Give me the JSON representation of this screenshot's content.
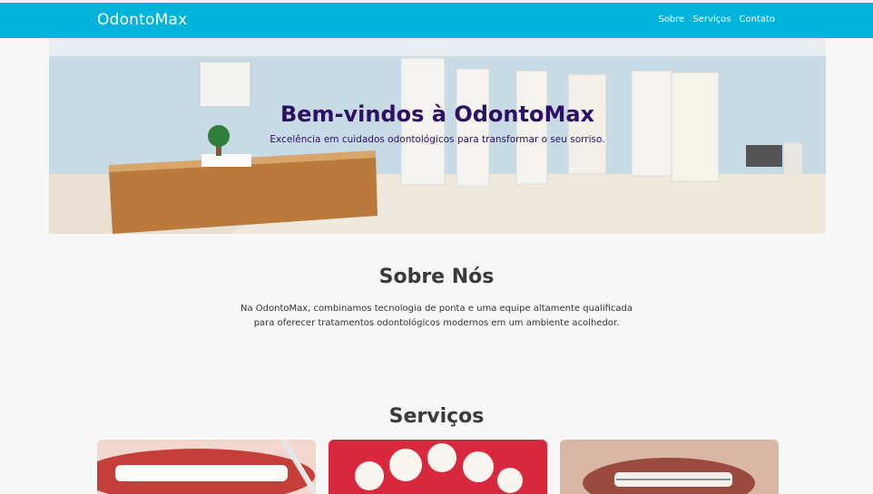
{
  "brand": "OdontoMax",
  "nav": {
    "about": "Sobre",
    "services": "Serviços",
    "contact": "Contato"
  },
  "hero": {
    "title": "Bem-vindos à OdontoMax",
    "subtitle": "Excelência em cuidados odontológicos para transformar o seu sorriso."
  },
  "about": {
    "title": "Sobre Nós",
    "text_line1": "Na OdontoMax, combinamos tecnologia de ponta e uma equipe altamente qualificada",
    "text_line2": "para oferecer tratamentos odontológicos modernos em um ambiente acolhedor."
  },
  "services": {
    "title": "Serviços"
  },
  "colors": {
    "navbar": "#00b3db",
    "hero_text": "#2d0f63",
    "background": "#f7f7f8"
  }
}
